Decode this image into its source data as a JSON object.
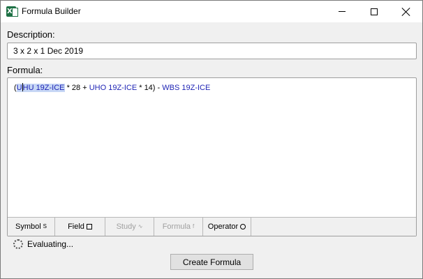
{
  "window": {
    "title": "Formula Builder",
    "app_icon": "excel-icon",
    "app_icon_letter": "X"
  },
  "description": {
    "label": "Description:",
    "value": "3 x 2 x 1 Dec 2019"
  },
  "formula": {
    "label": "Formula:",
    "tokens": {
      "t0": "(",
      "t1a": "U",
      "t1b": "HU 19Z-ICE",
      "t2": " * 28 + ",
      "t3": "UHO 19Z-ICE",
      "t4": " * 14) - ",
      "t5": "WBS 19Z-ICE"
    },
    "symbol_color": "#1f24b5",
    "selection_color": "#c7d7f5"
  },
  "tabs": [
    {
      "label": "Symbol",
      "icon": "S",
      "enabled": true
    },
    {
      "label": "Field",
      "icon": "square-icon",
      "enabled": true
    },
    {
      "label": "Study",
      "icon": "∿",
      "enabled": false
    },
    {
      "label": "Formula",
      "icon": "f",
      "enabled": false
    },
    {
      "label": "Operator",
      "icon": "circle-icon",
      "enabled": true
    }
  ],
  "status": {
    "text": "Evaluating..."
  },
  "actions": {
    "create_label": "Create Formula"
  }
}
